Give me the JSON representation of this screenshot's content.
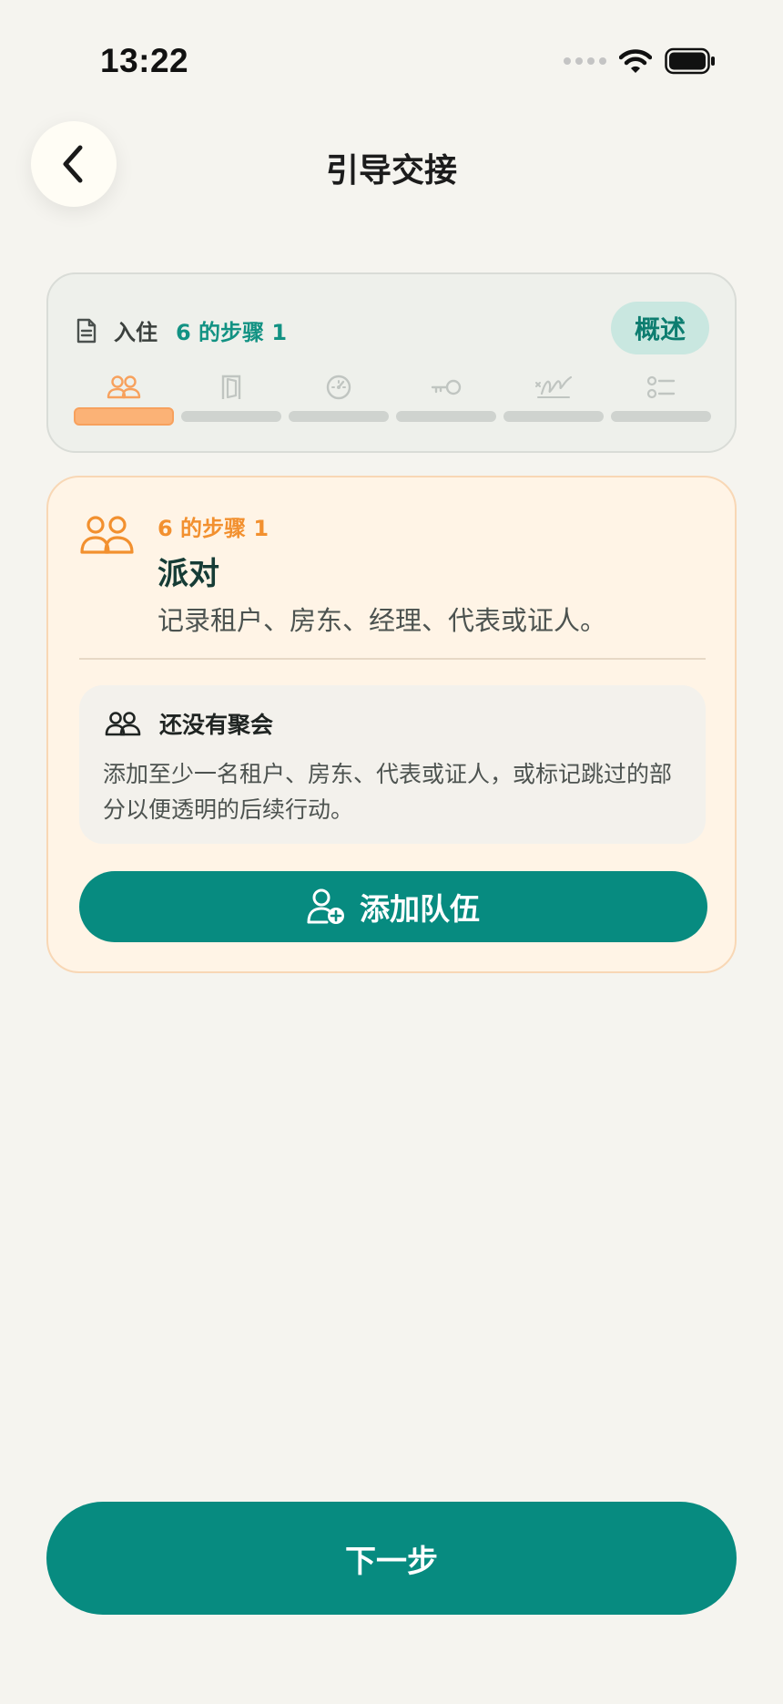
{
  "status_bar": {
    "time": "13:22"
  },
  "header": {
    "title": "引导交接"
  },
  "progress": {
    "section": "入住",
    "step_text": "6 的步骤 1",
    "overview_label": "概述",
    "steps": [
      {
        "icon": "people-icon",
        "state": "active"
      },
      {
        "icon": "door-icon",
        "state": "pending"
      },
      {
        "icon": "meter-icon",
        "state": "pending"
      },
      {
        "icon": "key-icon",
        "state": "pending"
      },
      {
        "icon": "signature-icon",
        "state": "pending"
      },
      {
        "icon": "checklist-icon",
        "state": "pending"
      }
    ]
  },
  "step_card": {
    "count": "6 的步骤 1",
    "title": "派对",
    "description": "记录租户、房东、经理、代表或证人。",
    "empty_state": {
      "title": "还没有聚会",
      "text": "添加至少一名租户、房东、代表或证人，或标记跳过的部分以便透明的后续行动。"
    },
    "add_button_label": "添加队伍"
  },
  "footer": {
    "next_label": "下一步"
  },
  "colors": {
    "accent": "#078b80",
    "orange": "#f2902f",
    "card_bg": "#fff4e6",
    "page_bg": "#f5f4ef"
  }
}
